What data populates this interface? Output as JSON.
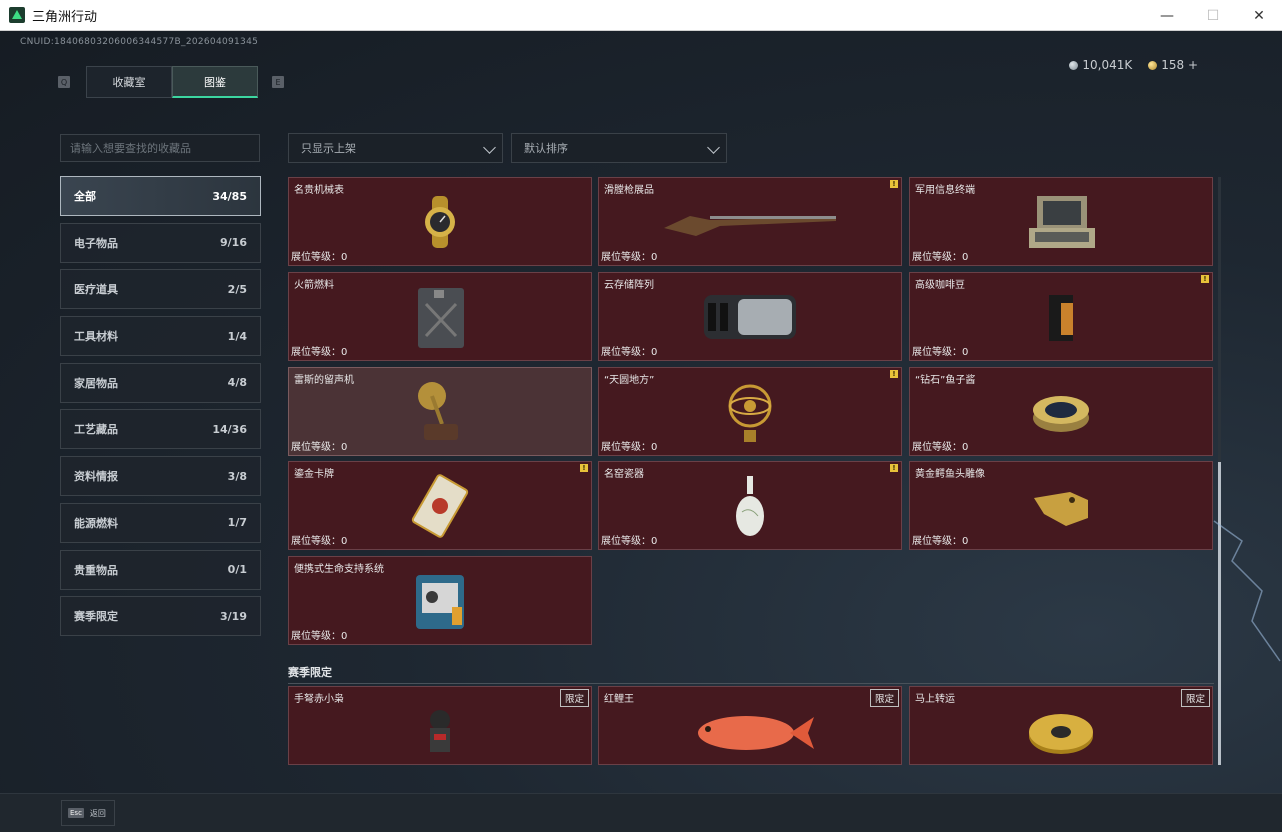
{
  "window": {
    "title": "三角洲行动"
  },
  "header": {
    "uid": "CNUID:18406803206006344577B_202604091345",
    "currency_silver": "10,041K",
    "currency_gold": "158 +",
    "tab_key_left": "Q",
    "tab_key_right": "E",
    "tabs": [
      "收藏室",
      "图鉴"
    ]
  },
  "search": {
    "placeholder": "请输入想要查找的收藏品"
  },
  "filters": {
    "shelf": "只显示上架",
    "sort": "默认排序"
  },
  "categories": [
    {
      "label": "全部",
      "count": "34/85"
    },
    {
      "label": "电子物品",
      "count": "9/16"
    },
    {
      "label": "医疗道具",
      "count": "2/5"
    },
    {
      "label": "工具材料",
      "count": "1/4"
    },
    {
      "label": "家居物品",
      "count": "4/8"
    },
    {
      "label": "工艺藏品",
      "count": "14/36"
    },
    {
      "label": "资料情报",
      "count": "3/8"
    },
    {
      "label": "能源燃料",
      "count": "1/7"
    },
    {
      "label": "贵重物品",
      "count": "0/1"
    },
    {
      "label": "赛季限定",
      "count": "3/19"
    }
  ],
  "level_text": "展位等级：0",
  "items": [
    {
      "name": "名贵机械表",
      "icon": "watch-icon"
    },
    {
      "name": "滑膛枪展品",
      "icon": "musket-icon",
      "mark": "!"
    },
    {
      "name": "军用信息终端",
      "icon": "terminal-icon"
    },
    {
      "name": "火箭燃料",
      "icon": "fuel-can-icon"
    },
    {
      "name": "云存储阵列",
      "icon": "storage-array-icon"
    },
    {
      "name": "高级咖啡豆",
      "icon": "coffee-bag-icon",
      "mark": "!"
    },
    {
      "name": "雷斯的留声机",
      "icon": "gramophone-icon"
    },
    {
      "name": "“天圆地方”",
      "icon": "armillary-icon",
      "mark": "!"
    },
    {
      "name": "“钻石”鱼子酱",
      "icon": "caviar-tin-icon"
    },
    {
      "name": "鎏金卡牌",
      "icon": "gold-card-icon",
      "mark": "!"
    },
    {
      "name": "名窑瓷器",
      "icon": "porcelain-vase-icon",
      "mark": "!"
    },
    {
      "name": "黄金鳄鱼头雕像",
      "icon": "croc-head-icon"
    },
    {
      "name": "便携式生命支持系统",
      "icon": "life-support-icon"
    }
  ],
  "season": {
    "title": "赛季限定",
    "tag": "限定",
    "items": [
      {
        "name": "手弩赤小枭",
        "icon": "figurine-icon"
      },
      {
        "name": "红鲤王",
        "icon": "koi-fish-icon"
      },
      {
        "name": "马上转运",
        "icon": "gold-disc-icon"
      }
    ]
  },
  "bottom": {
    "esc_key": "Esc",
    "esc_label": "返回"
  }
}
